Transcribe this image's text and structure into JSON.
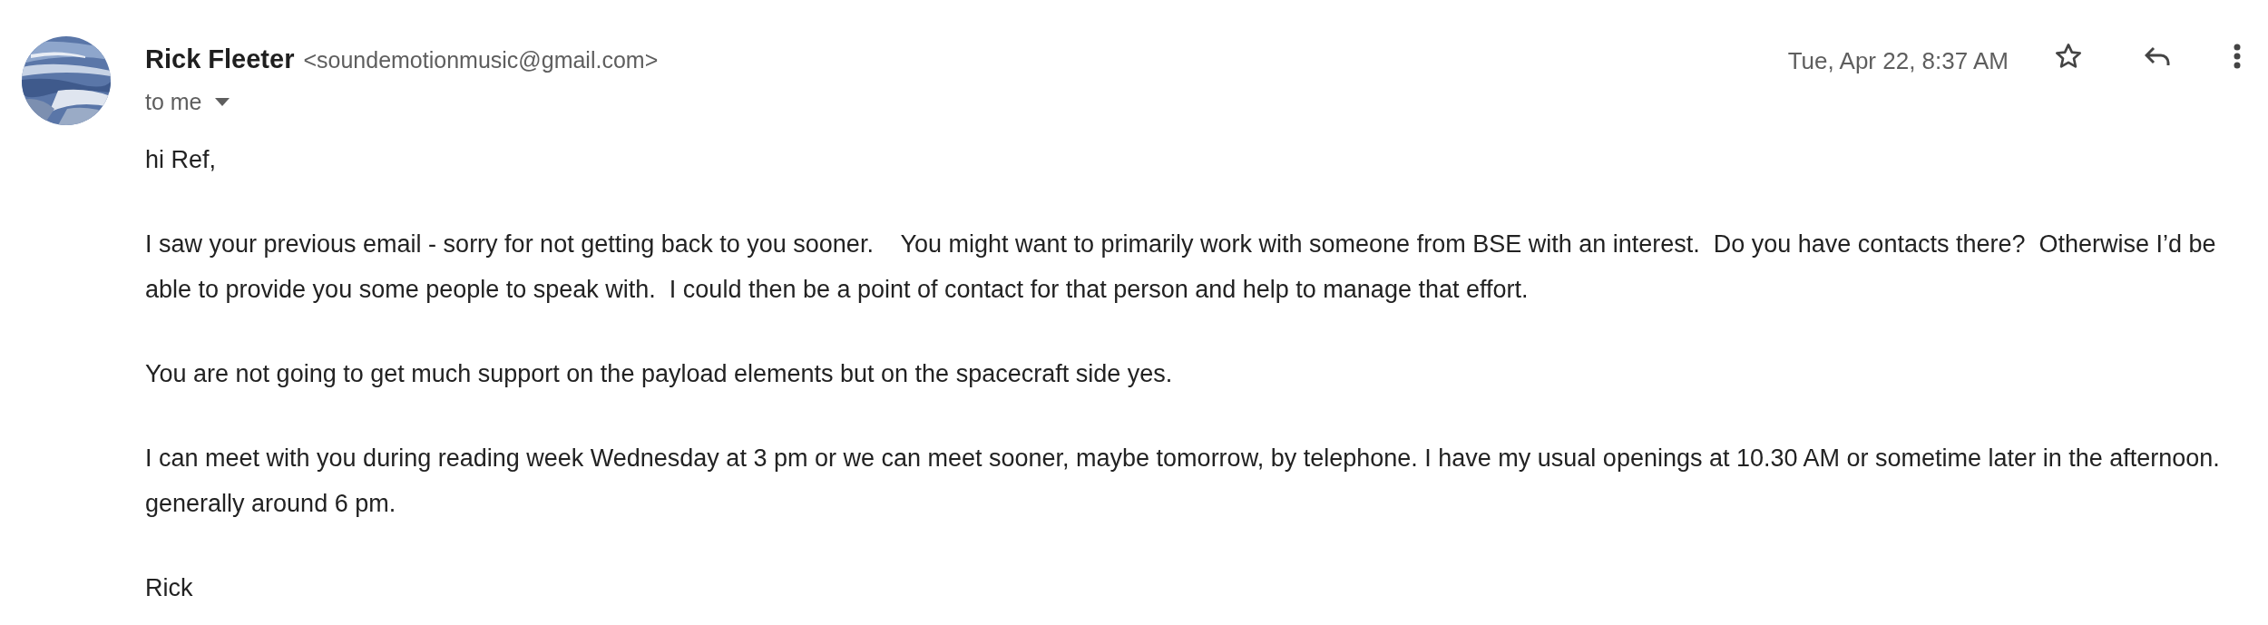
{
  "sender": {
    "name": "Rick Fleeter",
    "email": "<soundemotionmusic@gmail.com>"
  },
  "recipient": "to me",
  "date": "Tue, Apr 22, 8:37 AM",
  "starred": false,
  "body": [
    "hi Ref,",
    "I saw your previous email - sorry for not getting back to you sooner.    You might want to primarily work with someone from BSE with an interest.  Do you have contacts there?  Otherwise I’d be able to provide you some people to speak with.  I could then be a point of contact for that person and help to manage that effort.",
    "You are not going to get much support on the payload elements but on the spacecraft side yes.",
    "I can meet with you during reading week Wednesday at 3 pm or we can meet sooner, maybe tomorrow, by telephone. I have my usual openings at 10.30 AM or sometime later in the afternoon. generally around 6 pm.",
    "Rick"
  ]
}
